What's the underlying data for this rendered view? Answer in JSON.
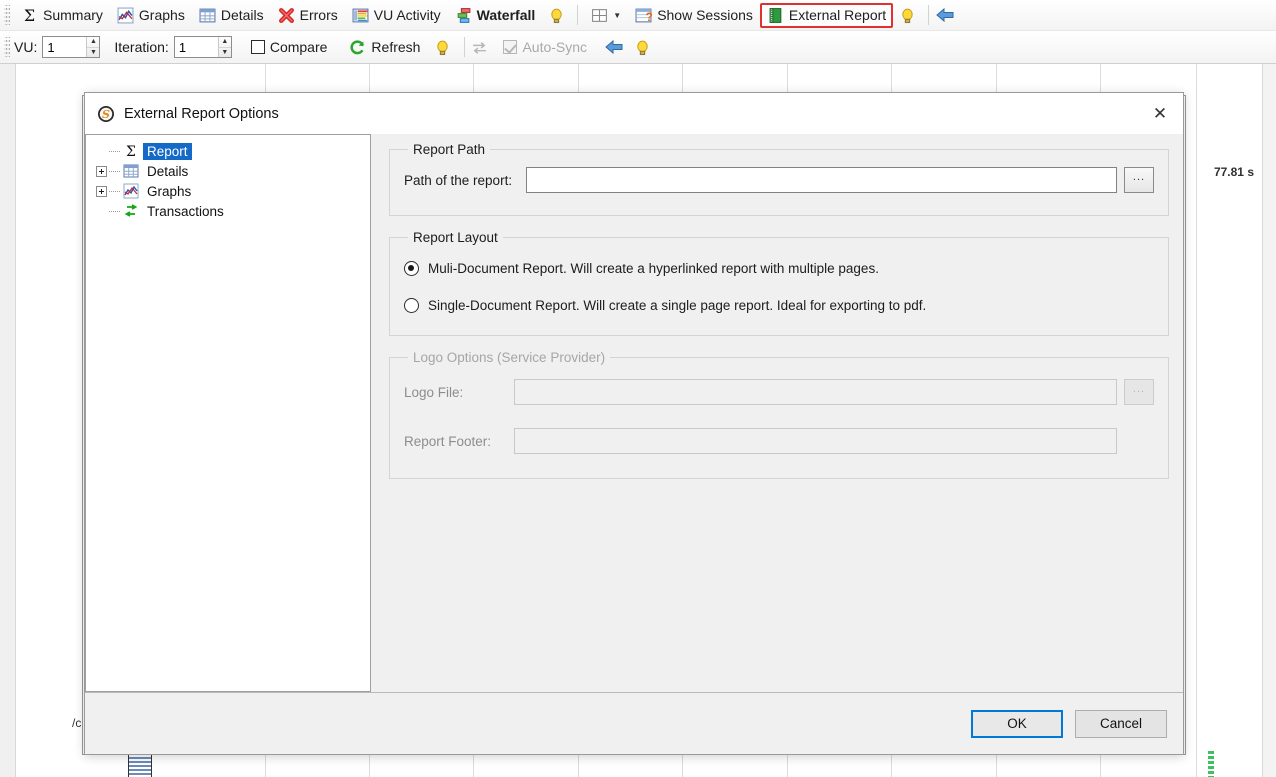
{
  "toolbar": {
    "row1": [
      {
        "label": "Summary",
        "icon": "sigma-icon",
        "bold": false,
        "highlighted": false
      },
      {
        "label": "Graphs",
        "icon": "line-chart-icon",
        "bold": false,
        "highlighted": false
      },
      {
        "label": "Details",
        "icon": "table-grid-icon",
        "bold": false,
        "highlighted": false
      },
      {
        "label": "Errors",
        "icon": "red-x-icon",
        "bold": false,
        "highlighted": false
      },
      {
        "label": "VU Activity",
        "icon": "bar-list-icon",
        "bold": false,
        "highlighted": false
      },
      {
        "label": "Waterfall",
        "icon": "waterfall-icon",
        "bold": true,
        "highlighted": false
      },
      {
        "label": "Show Sessions",
        "icon": "sessions-icon",
        "bold": false,
        "highlighted": false
      },
      {
        "label": "External Report",
        "icon": "external-report-icon",
        "bold": false,
        "highlighted": true
      }
    ],
    "row1_hints": [
      "lightbulb-icon",
      "lightbulb-icon"
    ],
    "row1_layout_icon": "layout-split-icon",
    "row1_back_icon": "blue-back-arrow-icon",
    "row2": {
      "vu_label": "VU:",
      "vu_value": "1",
      "iteration_label": "Iteration:",
      "iteration_value": "1",
      "compare_label": "Compare",
      "refresh_label": "Refresh",
      "autosync_label": "Auto-Sync",
      "refresh_icon": "green-refresh-icon",
      "swap_icon": "swap-arrows-icon",
      "hint_icon": "lightbulb-icon",
      "back_icon": "blue-back-arrow-icon"
    }
  },
  "background": {
    "time_label": "77.81 s",
    "path_label": "/c"
  },
  "dialog": {
    "title": "External Report Options",
    "app_icon": "s-logo-icon",
    "close_icon": "close-icon",
    "tree": [
      {
        "label": "Report",
        "icon": "sigma-icon",
        "expander": "none",
        "selected": true
      },
      {
        "label": "Details",
        "icon": "table-grid-icon",
        "expander": "plus",
        "selected": false
      },
      {
        "label": "Graphs",
        "icon": "line-chart-icon",
        "expander": "plus",
        "selected": false
      },
      {
        "label": "Transactions",
        "icon": "transaction-icon",
        "expander": "none",
        "selected": false
      }
    ],
    "report_path": {
      "legend": "Report Path",
      "field_label": "Path of the report:",
      "value": "",
      "placeholder": "",
      "browse_label": "..."
    },
    "report_layout": {
      "legend": "Report Layout",
      "options": [
        {
          "label": "Muli-Document Report. Will create a hyperlinked report with multiple pages.",
          "selected": true
        },
        {
          "label": "Single-Document Report. Will create a single page report. Ideal for exporting to pdf.",
          "selected": false
        }
      ]
    },
    "logo_options": {
      "legend": "Logo Options (Service Provider)",
      "disabled": true,
      "logo_file_label": "Logo File:",
      "logo_file_value": "",
      "report_footer_label": "Report Footer:",
      "report_footer_value": "",
      "browse_label": "..."
    },
    "footer": {
      "ok_label": "OK",
      "cancel_label": "Cancel"
    }
  },
  "colors": {
    "accent_blue": "#1569c7",
    "highlight_red": "#e03030",
    "default_button_border": "#0078d7",
    "dialog_bg": "#f0f0f0"
  }
}
